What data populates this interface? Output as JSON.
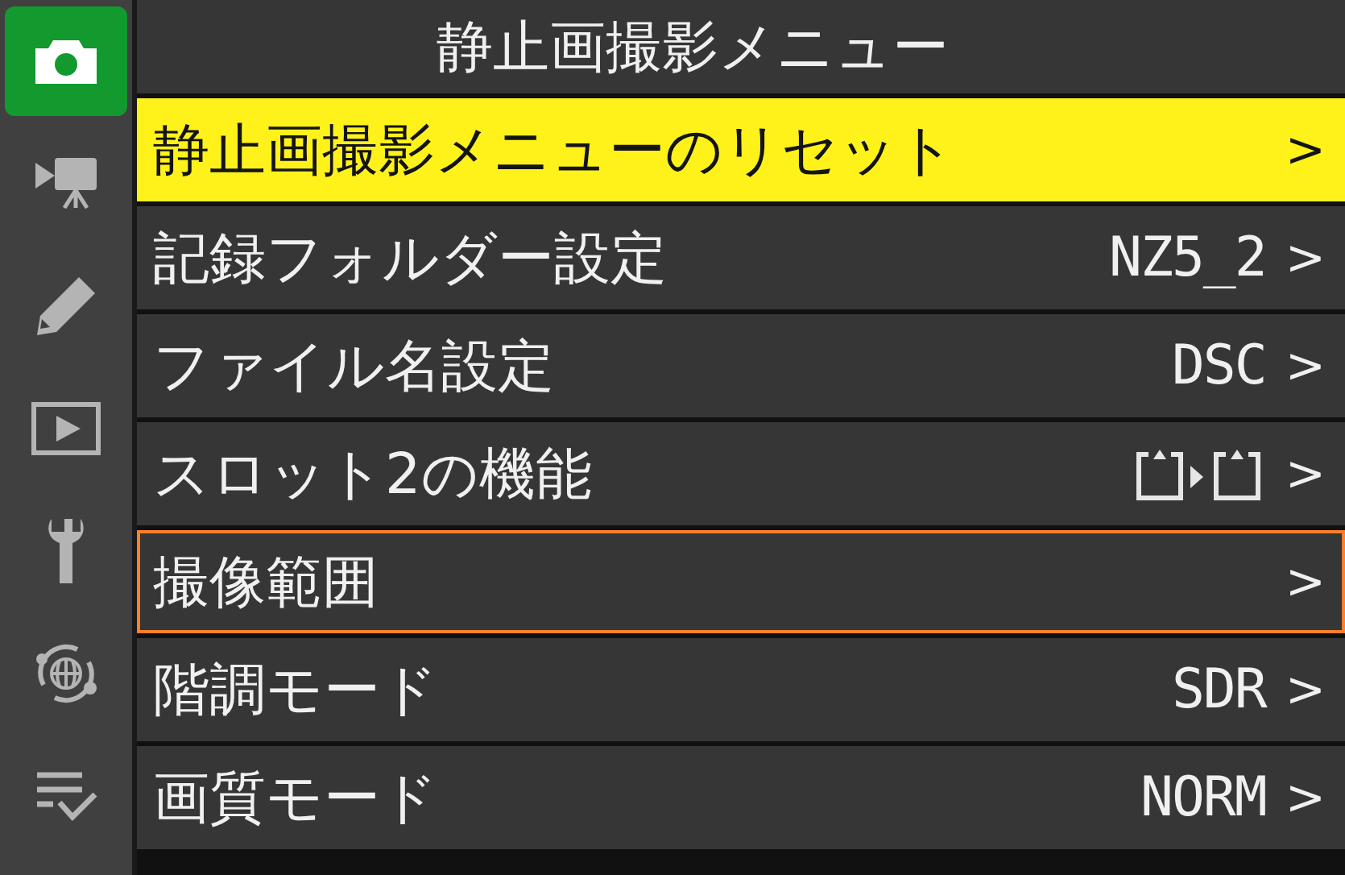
{
  "sidebar": {
    "items": [
      {
        "kind": "camera",
        "selected": true
      },
      {
        "kind": "movie",
        "selected": false
      },
      {
        "kind": "pencil",
        "selected": false
      },
      {
        "kind": "playback",
        "selected": false
      },
      {
        "kind": "wrench",
        "selected": false
      },
      {
        "kind": "network",
        "selected": false
      },
      {
        "kind": "checklist",
        "selected": false
      }
    ]
  },
  "title": "静止画撮影メニュー",
  "rows": [
    {
      "label": "静止画撮影メニューのリセット",
      "selected": true,
      "outlined": false,
      "kind": "none",
      "arrow": ">"
    },
    {
      "label": "記録フォルダー設定",
      "selected": false,
      "outlined": false,
      "kind": "text",
      "value": "NZ5_2",
      "arrow": ">"
    },
    {
      "label": "ファイル名設定",
      "selected": false,
      "outlined": false,
      "kind": "text",
      "value": "DSC",
      "arrow": ">"
    },
    {
      "label": "スロット2の機能",
      "selected": false,
      "outlined": false,
      "kind": "slot-icon",
      "arrow": ">"
    },
    {
      "label": "撮像範囲",
      "selected": false,
      "outlined": true,
      "kind": "none",
      "arrow": ">"
    },
    {
      "label": "階調モード",
      "selected": false,
      "outlined": false,
      "kind": "text",
      "value": "SDR",
      "arrow": ">"
    },
    {
      "label": "画質モード",
      "selected": false,
      "outlined": false,
      "kind": "text",
      "value": "NORM",
      "arrow": ">"
    }
  ]
}
